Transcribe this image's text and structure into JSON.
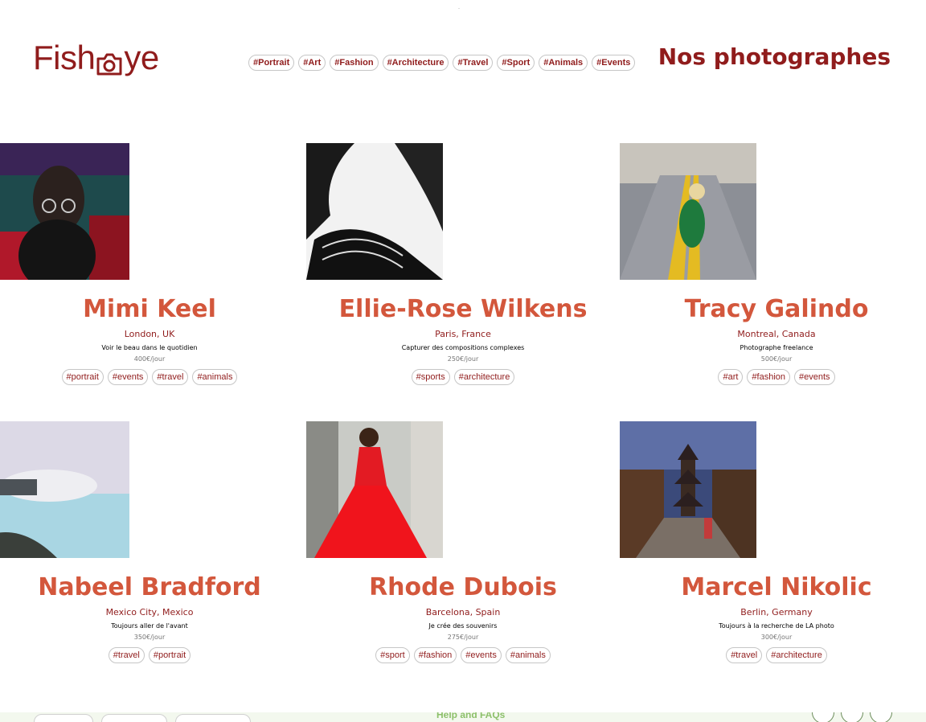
{
  "header": {
    "logo_text_left": "Fish",
    "logo_text_right": "ye",
    "title": "Nos photographes",
    "nav_tags": [
      "#Portrait",
      "#Art",
      "#Fashion",
      "#Architecture",
      "#Travel",
      "#Sport",
      "#Animals",
      "#Events"
    ]
  },
  "photographers": [
    {
      "name": "Mimi Keel",
      "location": "London, UK",
      "tagline": "Voir le beau dans le quotidien",
      "price": "400€/jour",
      "tags": [
        "#portrait",
        "#events",
        "#travel",
        "#animals"
      ]
    },
    {
      "name": "Ellie-Rose Wilkens",
      "location": "Paris, France",
      "tagline": "Capturer des compositions complexes",
      "price": "250€/jour",
      "tags": [
        "#sports",
        "#architecture"
      ]
    },
    {
      "name": "Tracy Galindo",
      "location": "Montreal, Canada",
      "tagline": "Photographe freelance",
      "price": "500€/jour",
      "tags": [
        "#art",
        "#fashion",
        "#events"
      ]
    },
    {
      "name": "Nabeel Bradford",
      "location": "Mexico City, Mexico",
      "tagline": "Toujours aller de l'avant",
      "price": "350€/jour",
      "tags": [
        "#travel",
        "#portrait"
      ]
    },
    {
      "name": "Rhode Dubois",
      "location": "Barcelona, Spain",
      "tagline": "Je crée des souvenirs",
      "price": "275€/jour",
      "tags": [
        "#sport",
        "#fashion",
        "#events",
        "#animals"
      ]
    },
    {
      "name": "Marcel Nikolic",
      "location": "Berlin, Germany",
      "tagline": "Toujours à la recherche de LA photo",
      "price": "300€/jour",
      "tags": [
        "#travel",
        "#architecture"
      ]
    }
  ],
  "footer": {
    "help_link": "Help and FAQs"
  },
  "colors": {
    "brand": "#901c1c",
    "name_accent": "#d3573c",
    "tag_border": "#c6c6c6"
  }
}
